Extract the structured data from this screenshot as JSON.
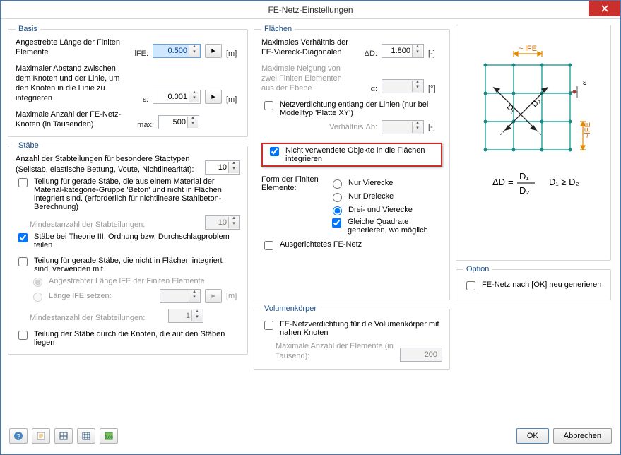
{
  "window": {
    "title": "FE-Netz-Einstellungen"
  },
  "basis": {
    "legend": "Basis",
    "len_label": "Angestrebte Länge der Finiten Elemente",
    "len_sym": "lFE:",
    "len_val": "0.500",
    "len_unit": "[m]",
    "dist_label": "Maximaler Abstand zwischen dem Knoten und der Linie, um den Knoten in die Linie zu integrieren",
    "dist_sym": "ε:",
    "dist_val": "0.001",
    "dist_unit": "[m]",
    "max_label": "Maximale Anzahl der FE-Netz-Knoten (in Tausenden)",
    "max_sym": "max:",
    "max_val": "500"
  },
  "staebe": {
    "legend": "Stäbe",
    "count_label": "Anzahl der Stabteilungen für besondere Stabtypen\n(Seilstab, elastische Bettung, Voute, Nichtlinearität):",
    "count_val": "10",
    "chk_beton": "Teilung für gerade Stäbe, die aus einem Material der Material-kategorie-Gruppe 'Beton' und nicht in Flächen integriert sind. (erforderlich für nichtlineare Stahlbeton-Berechnung)",
    "min_label": "Mindestanzahl der Stabteilungen:",
    "min_val": "10",
    "chk_theorie": "Stäbe bei Theorie III. Ordnung bzw. Durchschlagproblem teilen",
    "chk_notint": "Teilung für gerade Stäbe, die nicht in Flächen integriert sind, verwenden mit",
    "radio_angestr": "Angestrebter Länge lFE der Finiten Elemente",
    "radio_setzen": "Länge lFE setzen:",
    "setzen_unit": "[m]",
    "min2_label": "Mindestanzahl der Stabteilungen:",
    "min2_val": "1",
    "chk_knoten": "Teilung der Stäbe durch die Knoten, die auf den Stäben liegen"
  },
  "flaechen": {
    "legend": "Flächen",
    "diag_label": "Maximales Verhältnis der FE-Viereck-Diagonalen",
    "diag_sym": "ΔD:",
    "diag_val": "1.800",
    "diag_unit": "[-]",
    "neigung_label": "Maximale Neigung von zwei Finiten Elementen aus der Ebene",
    "neigung_sym": "α:",
    "neigung_unit": "[°]",
    "chk_verdicht": "Netzverdichtung entlang der Linien (nur bei Modelltyp 'Platte XY')",
    "verh_label": "Verhältnis Δb:",
    "verh_unit": "[-]",
    "chk_integr": "Nicht verwendete Objekte in die Flächen integrieren",
    "form_label": "Form der Finiten Elemente:",
    "radio_vier": "Nur Vierecke",
    "radio_drei": "Nur Dreiecke",
    "radio_dreivier": "Drei- und Vierecke",
    "chk_quad": "Gleiche Quadrate generieren, wo möglich",
    "chk_ausger": "Ausgerichtetes FE-Netz"
  },
  "volumen": {
    "legend": "Volumenkörper",
    "chk_verd": "FE-Netzverdichtung für die Volumenkörper mit nahen Knoten",
    "max_label": "Maximale Anzahl der Elemente (in Tausend):",
    "max_val": "200"
  },
  "option": {
    "legend": "Option",
    "chk_regen": "FE-Netz nach [OK] neu generieren"
  },
  "diagram": {
    "label_lfe_top": "~ lFE",
    "label_eps": "ε",
    "label_d1": "D₁",
    "label_d2": "D₂",
    "label_lfe_right": "~lFE",
    "formula_delta": "ΔD",
    "formula_d1": "D₁",
    "formula_d2": "D₂",
    "formula_cond": "D₁ ≥ D₂"
  },
  "buttons": {
    "ok": "OK",
    "cancel": "Abbrechen"
  }
}
